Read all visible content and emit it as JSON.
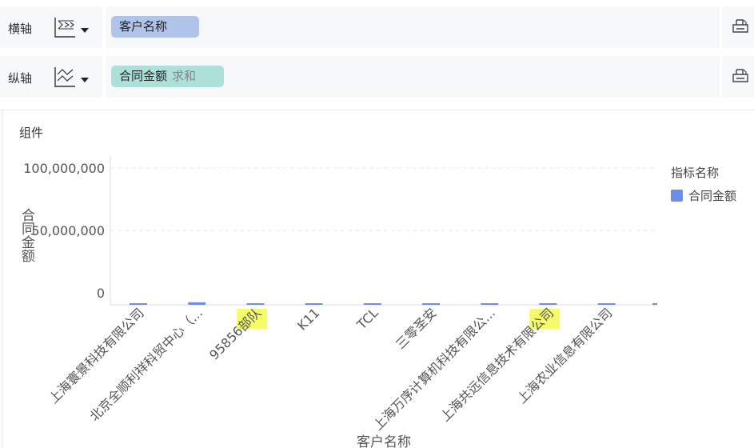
{
  "x_axis_row": {
    "label": "横轴",
    "icon": "bar-chart-x-icon",
    "field": "客户名称"
  },
  "y_axis_row": {
    "label": "纵轴",
    "icon": "line-chart-y-icon",
    "field": "合同金额",
    "aggregation": "求和"
  },
  "settings_icon": "printer-settings-icon",
  "component_title": "组件",
  "legend": {
    "title": "指标名称",
    "items": [
      "合同金额"
    ]
  },
  "colors": {
    "series": "#6b8fe8",
    "pill_dimension": "#b0c3e9",
    "pill_measure": "#aee0da",
    "highlight": "#f5fb6a"
  },
  "chart_data": {
    "type": "bar",
    "title": "",
    "xlabel": "客户名称",
    "ylabel": "合同金额",
    "ylim": [
      -10000000,
      110000000
    ],
    "yticks": [
      0,
      50000000,
      100000000
    ],
    "ytick_labels": [
      "0",
      "50,000,000",
      "100,000,000"
    ],
    "grid": true,
    "legend_position": "right",
    "categories": [
      "上海寰景科技有限公司",
      "北京全顺利祥科贸中心（...",
      "95856部队",
      "K11",
      "TCL",
      "三零圣安",
      "上海万序计算机科技有限公...",
      "上海共远信息技术有限公司",
      "上海农业信息有限公司"
    ],
    "series": [
      {
        "name": "合同金额",
        "values": [
          500000,
          2000000,
          400000,
          300000,
          300000,
          300000,
          500000,
          400000,
          400000
        ]
      }
    ]
  }
}
